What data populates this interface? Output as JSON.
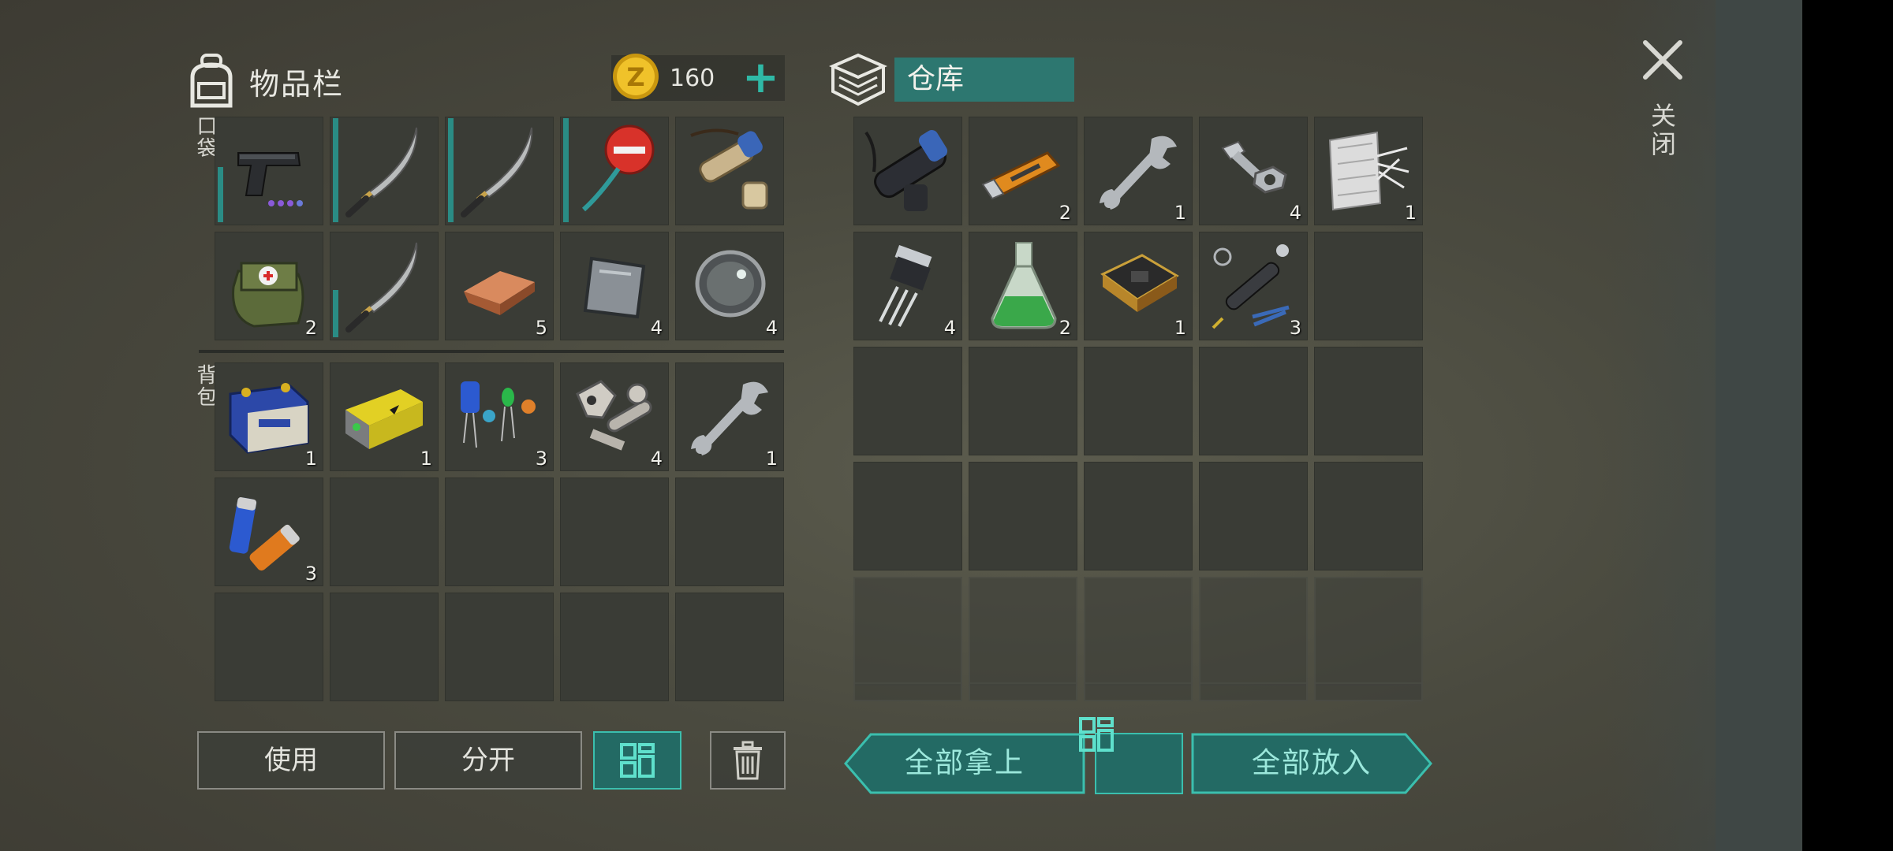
{
  "inventory": {
    "title": "物品栏",
    "coins": "160",
    "add_label": "+",
    "pocket_label": "口袋",
    "backpack_label": "背包",
    "pocket_items": [
      {
        "name": "pistol",
        "count": "",
        "icon": "pistol-icon"
      },
      {
        "name": "katana",
        "count": "",
        "icon": "katana-icon"
      },
      {
        "name": "katana",
        "count": "",
        "icon": "katana-icon"
      },
      {
        "name": "stop-sign",
        "count": "",
        "icon": "stop-sign-icon"
      },
      {
        "name": "scope-pouch",
        "count": "",
        "icon": "scope-pouch-icon"
      },
      {
        "name": "medkit-bag",
        "count": "2",
        "icon": "medkit-bag-icon"
      },
      {
        "name": "katana",
        "count": "",
        "icon": "katana-icon"
      },
      {
        "name": "copper-ingot",
        "count": "5",
        "icon": "copper-ingot-icon"
      },
      {
        "name": "steel-plate",
        "count": "4",
        "icon": "steel-plate-icon"
      },
      {
        "name": "lens",
        "count": "4",
        "icon": "lens-icon"
      }
    ],
    "backpack_items": [
      {
        "name": "car-battery",
        "count": "1",
        "icon": "car-battery-icon"
      },
      {
        "name": "power-cell",
        "count": "1",
        "icon": "power-cell-icon"
      },
      {
        "name": "capacitors",
        "count": "3",
        "icon": "capacitors-icon"
      },
      {
        "name": "engine-parts",
        "count": "4",
        "icon": "engine-parts-icon"
      },
      {
        "name": "wrench",
        "count": "1",
        "icon": "wrench-icon"
      },
      {
        "name": "batteries",
        "count": "3",
        "icon": "batteries-icon"
      }
    ],
    "buttons": {
      "use": "使用",
      "split": "分开"
    }
  },
  "storage": {
    "title": "仓库",
    "items": [
      {
        "name": "scope",
        "count": "",
        "icon": "scope-icon"
      },
      {
        "name": "usb-drive",
        "count": "2",
        "icon": "usb-drive-icon"
      },
      {
        "name": "wrench",
        "count": "1",
        "icon": "wrench-icon"
      },
      {
        "name": "bolts",
        "count": "4",
        "icon": "bolts-icon"
      },
      {
        "name": "fiberglass",
        "count": "1",
        "icon": "fiberglass-icon"
      },
      {
        "name": "transistor",
        "count": "4",
        "icon": "transistor-icon"
      },
      {
        "name": "chemical-flask",
        "count": "2",
        "icon": "flask-icon"
      },
      {
        "name": "circuit-board",
        "count": "1",
        "icon": "circuit-board-icon"
      },
      {
        "name": "soldering-tools",
        "count": "3",
        "icon": "soldering-tools-icon"
      }
    ],
    "buttons": {
      "take_all": "全部拿上",
      "put_all": "全部放入"
    }
  },
  "close_label": "关闭",
  "colors": {
    "accent": "#2d7770",
    "accent_bright": "#3bbfae",
    "cell": "#3a3c36"
  }
}
